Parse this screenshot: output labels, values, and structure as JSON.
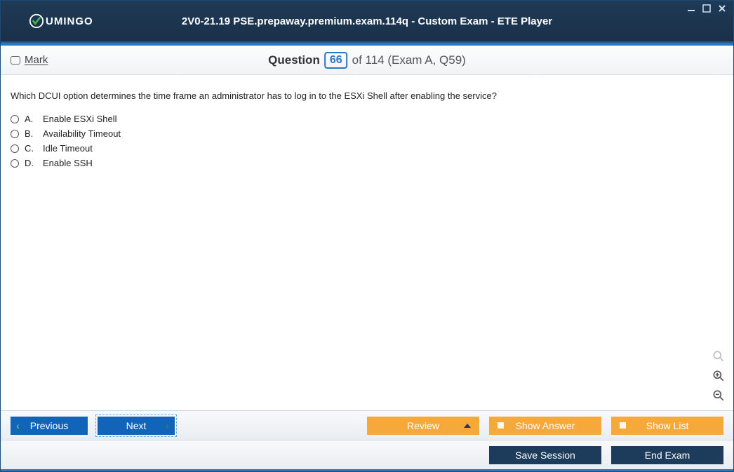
{
  "brand": "UMINGO",
  "window_title": "2V0-21.19 PSE.prepaway.premium.exam.114q - Custom Exam - ETE Player",
  "mark_label": "Mark",
  "question": {
    "word": "Question",
    "current": "66",
    "total_info": "of 114 (Exam A, Q59)",
    "text": "Which DCUI option determines the time frame an administrator has to log in to the ESXi Shell after enabling the service?",
    "options": [
      {
        "letter": "A.",
        "text": "Enable ESXi Shell"
      },
      {
        "letter": "B.",
        "text": "Availability Timeout"
      },
      {
        "letter": "C.",
        "text": "Idle Timeout"
      },
      {
        "letter": "D.",
        "text": "Enable SSH"
      }
    ]
  },
  "buttons": {
    "previous": "Previous",
    "next": "Next",
    "review": "Review",
    "show_answer": "Show Answer",
    "show_list": "Show List",
    "save_session": "Save Session",
    "end_exam": "End Exam"
  }
}
